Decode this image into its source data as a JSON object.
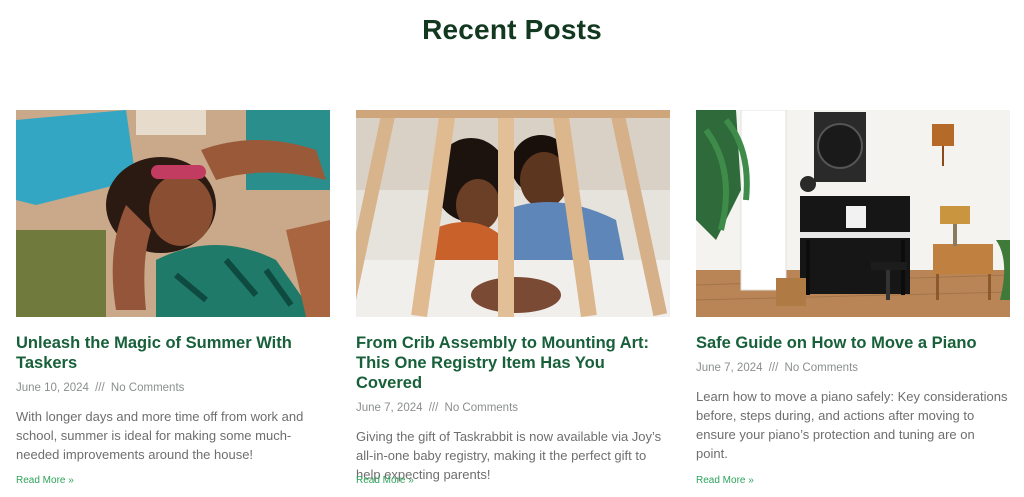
{
  "section": {
    "title": "Recent Posts"
  },
  "posts": [
    {
      "title": "Unleash the Magic of Summer With Taskers",
      "date": "June 10, 2024",
      "separator": "///",
      "comments": "No Comments",
      "excerpt": "With longer days and more time off from work and school, summer is ideal for making some much-needed improvements around the house!",
      "read_more": "Read More »"
    },
    {
      "title": "From Crib Assembly to Mounting Art: This One Registry Item Has You Covered",
      "date": "June 7, 2024",
      "separator": "///",
      "comments": "No Comments",
      "excerpt": "Giving the gift of Taskrabbit is now available via Joy’s all-in-one baby registry, making it the perfect gift to help expecting parents!",
      "read_more": "Read More »"
    },
    {
      "title": "Safe Guide on How to Move a Piano",
      "date": "June 7, 2024",
      "separator": "///",
      "comments": "No Comments",
      "excerpt": "Learn how to move a piano safely: Key considerations before, steps during, and actions after moving to ensure your piano’s protection and tuning are on point.",
      "read_more": "Read More »"
    }
  ],
  "colors": {
    "heading": "#12391f",
    "post_title": "#17603a",
    "meta": "#8a8f8c",
    "excerpt": "#6e6e6e",
    "link": "#2fa35c"
  }
}
